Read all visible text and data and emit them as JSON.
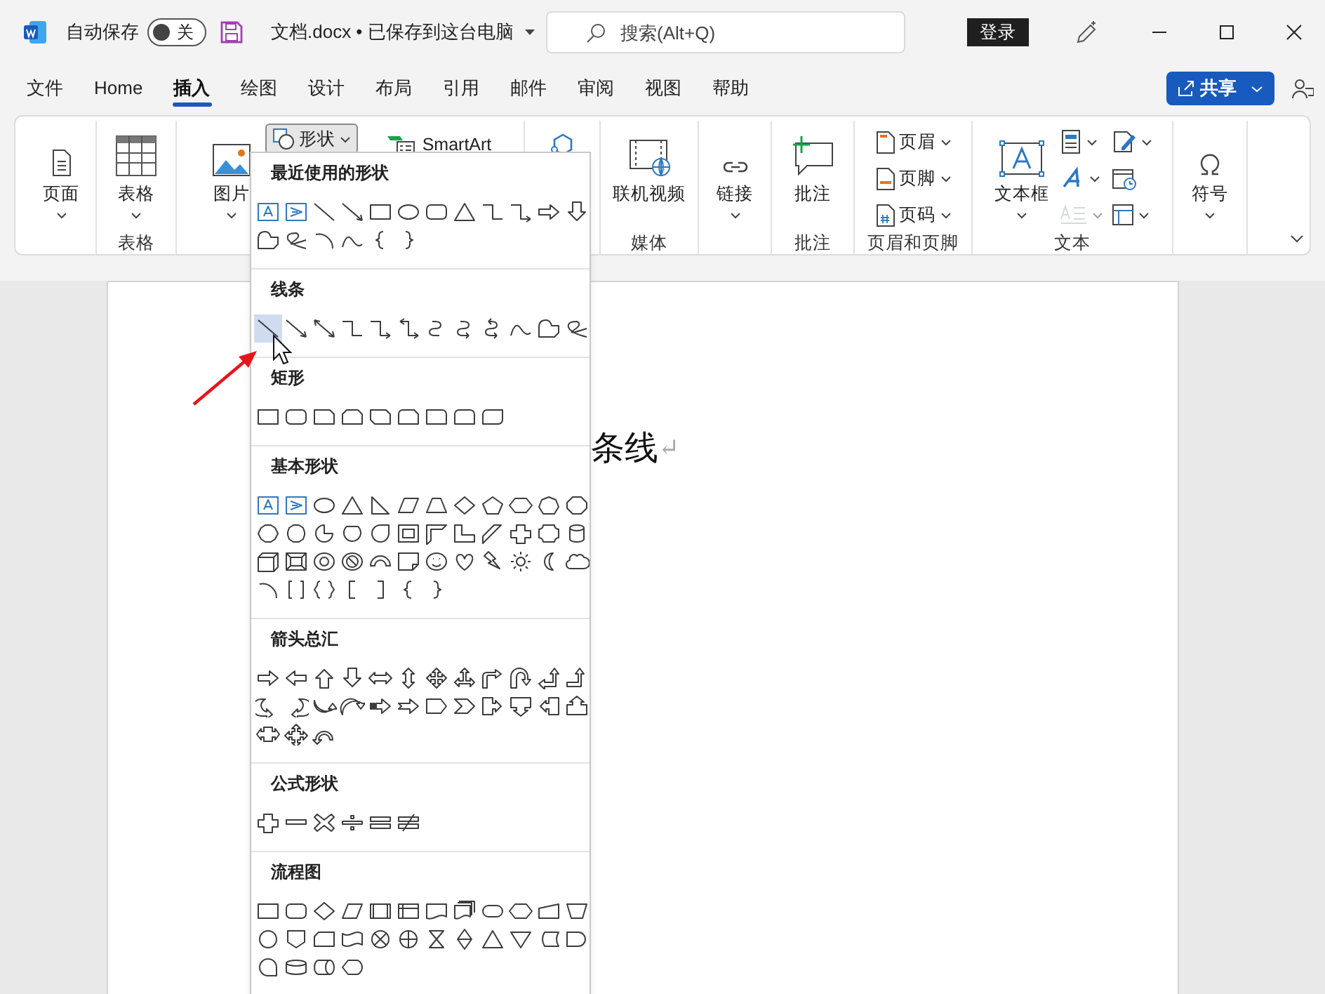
{
  "title_bar": {
    "autosave_label": "自动保存",
    "autosave": {
      "on": false,
      "label": "关"
    },
    "document_title": "文档.docx • 已保存到这台电脑",
    "search_placeholder": "搜索(Alt+Q)",
    "sign_in": "登录"
  },
  "ribbon_tabs": [
    {
      "label": "文件",
      "selected": false
    },
    {
      "label": "Home",
      "selected": false
    },
    {
      "label": "插入",
      "selected": true
    },
    {
      "label": "绘图",
      "selected": false
    },
    {
      "label": "设计",
      "selected": false
    },
    {
      "label": "布局",
      "selected": false
    },
    {
      "label": "引用",
      "selected": false
    },
    {
      "label": "邮件",
      "selected": false
    },
    {
      "label": "审阅",
      "selected": false
    },
    {
      "label": "视图",
      "selected": false
    },
    {
      "label": "帮助",
      "selected": false
    }
  ],
  "share_button": "共享",
  "ribbon_groups": [
    {
      "items": [
        {
          "kind": "large",
          "label": "页面",
          "dropdown": true
        }
      ]
    },
    {
      "label": "表格",
      "items": [
        {
          "kind": "large",
          "label": "表格",
          "dropdown": true
        }
      ]
    },
    {
      "items": [
        {
          "kind": "large",
          "label": "图片",
          "dropdown": true
        },
        {
          "kind": "shapes",
          "label": "形状",
          "open": true
        },
        {
          "kind": "inline",
          "label": "SmartArt"
        }
      ]
    },
    {
      "items": [
        {
          "kind": "bare"
        }
      ]
    },
    {
      "label": "媒体",
      "items": [
        {
          "kind": "large",
          "label": "联机视频",
          "dropdown": false
        }
      ]
    },
    {
      "items": [
        {
          "kind": "large",
          "label": "链接",
          "dropdown": true
        }
      ]
    },
    {
      "label": "批注",
      "items": [
        {
          "kind": "large",
          "label": "批注",
          "dropdown": false
        }
      ]
    },
    {
      "label": "页眉和页脚",
      "items": [
        {
          "kind": "stack",
          "entries": [
            {
              "label": "页眉",
              "dropdown": true,
              "disabled": false
            },
            {
              "label": "页脚",
              "dropdown": true,
              "disabled": false
            },
            {
              "label": "页码",
              "dropdown": true,
              "disabled": false
            }
          ]
        }
      ]
    },
    {
      "label": "文本",
      "items": [
        {
          "kind": "large",
          "label": "文本框",
          "dropdown": true
        },
        {
          "kind": "stack",
          "entries": [
            {
              "dropdown": true,
              "disabled": false
            },
            {
              "dropdown": true,
              "disabled": false
            },
            {
              "dropdown": true,
              "disabled": true
            }
          ]
        },
        {
          "kind": "stack",
          "entries": [
            {
              "dropdown": true,
              "disabled": false
            },
            {
              "dropdown": false,
              "disabled": false
            },
            {
              "dropdown": true,
              "disabled": false
            }
          ]
        }
      ]
    },
    {
      "items": [
        {
          "kind": "large",
          "label": "符号",
          "dropdown": true
        }
      ]
    }
  ],
  "document": {
    "text": "条线",
    "paragraph_mark": "↵"
  },
  "shapes_menu": {
    "sections": [
      {
        "title": "最近使用的形状",
        "shapes": [
          {
            "kind": "textbox",
            "selected": false
          },
          {
            "kind": "vertical-textbox",
            "selected": false
          },
          {
            "kind": "line",
            "selected": false
          },
          {
            "kind": "arrow-line",
            "selected": false
          },
          {
            "kind": "rect",
            "selected": false
          },
          {
            "kind": "oval",
            "selected": false
          },
          {
            "kind": "rounded-rect",
            "selected": false
          },
          {
            "kind": "triangle",
            "selected": false
          },
          {
            "kind": "elbow",
            "selected": false
          },
          {
            "kind": "elbow-arrow",
            "selected": false
          },
          {
            "kind": "right-arrow",
            "selected": false
          },
          {
            "kind": "down-arrow",
            "selected": false
          },
          {
            "kind": "freeform",
            "selected": false
          },
          {
            "kind": "scribble",
            "selected": false
          },
          {
            "kind": "arc",
            "selected": false
          },
          {
            "kind": "curve",
            "selected": false
          },
          {
            "kind": "brace-left",
            "selected": false
          },
          {
            "kind": "brace-right",
            "selected": false
          }
        ]
      },
      {
        "title": "线条",
        "shapes": [
          {
            "kind": "line",
            "selected": true
          },
          {
            "kind": "arrow-line",
            "selected": false
          },
          {
            "kind": "double-arrow-line",
            "selected": false
          },
          {
            "kind": "elbow",
            "selected": false
          },
          {
            "kind": "elbow-arrow",
            "selected": false
          },
          {
            "kind": "elbow-double-arrow",
            "selected": false
          },
          {
            "kind": "curved-connector",
            "selected": false
          },
          {
            "kind": "curved-arrow",
            "selected": false
          },
          {
            "kind": "curved-double-arrow",
            "selected": false
          },
          {
            "kind": "curve",
            "selected": false
          },
          {
            "kind": "freeform",
            "selected": false
          },
          {
            "kind": "scribble",
            "selected": false
          }
        ]
      },
      {
        "title": "矩形",
        "shapes": [
          {
            "kind": "rect",
            "selected": false
          },
          {
            "kind": "rounded-rect",
            "selected": false
          },
          {
            "kind": "snip-rect",
            "selected": false
          },
          {
            "kind": "snip-two",
            "selected": false
          },
          {
            "kind": "snip-diag",
            "selected": false
          },
          {
            "kind": "snip-round",
            "selected": false
          },
          {
            "kind": "round-one",
            "selected": false
          },
          {
            "kind": "round-same",
            "selected": false
          },
          {
            "kind": "round-diag",
            "selected": false
          }
        ]
      },
      {
        "title": "基本形状",
        "shapes": [
          {
            "kind": "textbox",
            "selected": false
          },
          {
            "kind": "vertical-textbox",
            "selected": false
          },
          {
            "kind": "oval",
            "selected": false
          },
          {
            "kind": "triangle",
            "selected": false
          },
          {
            "kind": "right-triangle",
            "selected": false
          },
          {
            "kind": "parallelogram",
            "selected": false
          },
          {
            "kind": "trapezoid",
            "selected": false
          },
          {
            "kind": "diamond",
            "selected": false
          },
          {
            "kind": "pentagon",
            "selected": false
          },
          {
            "kind": "hexagon",
            "selected": false
          },
          {
            "kind": "heptagon",
            "selected": false
          },
          {
            "kind": "octagon",
            "selected": false
          },
          {
            "kind": "decagon",
            "selected": false
          },
          {
            "kind": "dodecagon",
            "selected": false
          },
          {
            "kind": "pie",
            "selected": false
          },
          {
            "kind": "chord",
            "selected": false
          },
          {
            "kind": "teardrop",
            "selected": false
          },
          {
            "kind": "frame",
            "selected": false
          },
          {
            "kind": "half-frame",
            "selected": false
          },
          {
            "kind": "l-shape",
            "selected": false
          },
          {
            "kind": "diagonal-stripe",
            "selected": false
          },
          {
            "kind": "cross",
            "selected": false
          },
          {
            "kind": "plaque",
            "selected": false
          },
          {
            "kind": "can",
            "selected": false
          },
          {
            "kind": "cube",
            "selected": false
          },
          {
            "kind": "bevel",
            "selected": false
          },
          {
            "kind": "donut",
            "selected": false
          },
          {
            "kind": "no-symbol",
            "selected": false
          },
          {
            "kind": "block-arc",
            "selected": false
          },
          {
            "kind": "folded-corner",
            "selected": false
          },
          {
            "kind": "smiley",
            "selected": false
          },
          {
            "kind": "heart",
            "selected": false
          },
          {
            "kind": "lightning",
            "selected": false
          },
          {
            "kind": "sun",
            "selected": false
          },
          {
            "kind": "moon",
            "selected": false
          },
          {
            "kind": "cloud",
            "selected": false
          },
          {
            "kind": "arc",
            "selected": false
          },
          {
            "kind": "bracket-pair",
            "selected": false
          },
          {
            "kind": "brace-pair",
            "selected": false
          },
          {
            "kind": "bracket-left",
            "selected": false
          },
          {
            "kind": "bracket-right",
            "selected": false
          },
          {
            "kind": "brace-left",
            "selected": false
          },
          {
            "kind": "brace-right",
            "selected": false
          }
        ]
      },
      {
        "title": "箭头总汇",
        "shapes": [
          {
            "kind": "right-arrow",
            "selected": false
          },
          {
            "kind": "left-arrow",
            "selected": false
          },
          {
            "kind": "up-arrow",
            "selected": false
          },
          {
            "kind": "down-arrow",
            "selected": false
          },
          {
            "kind": "left-right-arrow",
            "selected": false
          },
          {
            "kind": "up-down-arrow",
            "selected": false
          },
          {
            "kind": "quad-arrow",
            "selected": false
          },
          {
            "kind": "left-right-up-arrow",
            "selected": false
          },
          {
            "kind": "bent-arrow",
            "selected": false
          },
          {
            "kind": "u-turn-arrow",
            "selected": false
          },
          {
            "kind": "left-up-arrow",
            "selected": false
          },
          {
            "kind": "bent-up-arrow",
            "selected": false
          },
          {
            "kind": "curved-right-arrow",
            "selected": false
          },
          {
            "kind": "curved-left-arrow",
            "selected": false
          },
          {
            "kind": "curved-up-arrow",
            "selected": false
          },
          {
            "kind": "curved-down-arrow",
            "selected": false
          },
          {
            "kind": "striped-right-arrow",
            "selected": false
          },
          {
            "kind": "notched-right-arrow",
            "selected": false
          },
          {
            "kind": "pentagon-arrow",
            "selected": false
          },
          {
            "kind": "chevron",
            "selected": false
          },
          {
            "kind": "right-callout",
            "selected": false
          },
          {
            "kind": "down-callout",
            "selected": false
          },
          {
            "kind": "left-callout",
            "selected": false
          },
          {
            "kind": "up-callout",
            "selected": false
          },
          {
            "kind": "left-right-callout",
            "selected": false
          },
          {
            "kind": "quad-callout",
            "selected": false
          },
          {
            "kind": "circular-arrow",
            "selected": false
          }
        ]
      },
      {
        "title": "公式形状",
        "shapes": [
          {
            "kind": "plus",
            "selected": false
          },
          {
            "kind": "minus",
            "selected": false
          },
          {
            "kind": "multiply",
            "selected": false
          },
          {
            "kind": "divide",
            "selected": false
          },
          {
            "kind": "equal",
            "selected": false
          },
          {
            "kind": "not-equal",
            "selected": false
          }
        ]
      },
      {
        "title": "流程图",
        "shapes": [
          {
            "kind": "rect",
            "selected": false
          },
          {
            "kind": "rounded-rect",
            "selected": false
          },
          {
            "kind": "diamond",
            "selected": false
          },
          {
            "kind": "parallelogram",
            "selected": false
          },
          {
            "kind": "predefined",
            "selected": false
          },
          {
            "kind": "internal-storage",
            "selected": false
          },
          {
            "kind": "document",
            "selected": false
          },
          {
            "kind": "multidocument",
            "selected": false
          },
          {
            "kind": "terminator",
            "selected": false
          },
          {
            "kind": "hexagon",
            "selected": false
          },
          {
            "kind": "manual-input",
            "selected": false
          },
          {
            "kind": "manual-operation",
            "selected": false
          },
          {
            "kind": "circle",
            "selected": false
          },
          {
            "kind": "offpage",
            "selected": false
          },
          {
            "kind": "card",
            "selected": false
          },
          {
            "kind": "punched-tape",
            "selected": false
          },
          {
            "kind": "summing-junction",
            "selected": false
          },
          {
            "kind": "or",
            "selected": false
          },
          {
            "kind": "collate",
            "selected": false
          },
          {
            "kind": "sort",
            "selected": false
          },
          {
            "kind": "extract",
            "selected": false
          },
          {
            "kind": "merge",
            "selected": false
          },
          {
            "kind": "stored-data",
            "selected": false
          },
          {
            "kind": "delay",
            "selected": false
          },
          {
            "kind": "sequential-storage",
            "selected": false
          },
          {
            "kind": "magnetic-disk",
            "selected": false
          },
          {
            "kind": "direct-access",
            "selected": false
          },
          {
            "kind": "display",
            "selected": false
          }
        ]
      }
    ]
  }
}
